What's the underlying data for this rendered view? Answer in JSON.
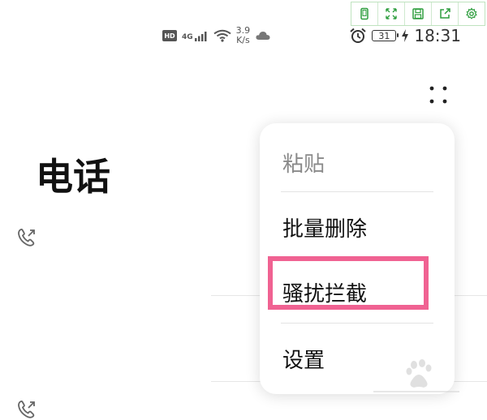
{
  "status_bar": {
    "hd": "HD",
    "network": "4G",
    "speed_value": "3.9",
    "speed_unit": "K/s",
    "battery": "31",
    "time": "18:31"
  },
  "page": {
    "title": "电话"
  },
  "menu": {
    "items": [
      {
        "label": "粘贴",
        "enabled": false
      },
      {
        "label": "批量删除",
        "enabled": true
      },
      {
        "label": "骚扰拦截",
        "enabled": true,
        "highlighted": true
      },
      {
        "label": "设置",
        "enabled": true
      }
    ]
  },
  "toolbar": {
    "icons": [
      "phone-frame-icon",
      "fullscreen-icon",
      "save-icon",
      "share-icon",
      "settings-icon"
    ]
  },
  "colors": {
    "highlight": "#f06292",
    "toolbar_green": "#2e9e3e"
  }
}
